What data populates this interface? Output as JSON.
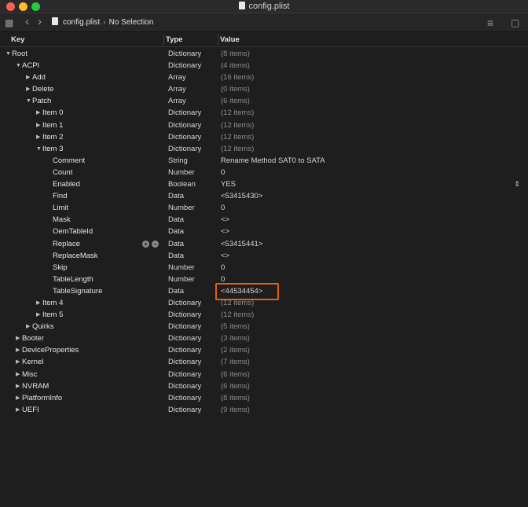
{
  "window": {
    "title": "config.plist"
  },
  "breadcrumb": {
    "file": "config.plist",
    "selection": "No Selection"
  },
  "columns": {
    "key": "Key",
    "type": "Type",
    "value": "Value"
  },
  "rows": [
    {
      "indent": 0,
      "tri": "open",
      "key": "Root",
      "type": "Dictionary",
      "value": "(8 items)",
      "dim": true
    },
    {
      "indent": 1,
      "tri": "open",
      "key": "ACPI",
      "type": "Dictionary",
      "value": "(4 items)",
      "dim": true
    },
    {
      "indent": 2,
      "tri": "closed",
      "key": "Add",
      "type": "Array",
      "value": "(16 items)",
      "dim": true
    },
    {
      "indent": 2,
      "tri": "closed",
      "key": "Delete",
      "type": "Array",
      "value": "(0 items)",
      "dim": true
    },
    {
      "indent": 2,
      "tri": "open",
      "key": "Patch",
      "type": "Array",
      "value": "(6 items)",
      "dim": true
    },
    {
      "indent": 3,
      "tri": "closed",
      "key": "Item 0",
      "type": "Dictionary",
      "value": "(12 items)",
      "dim": true
    },
    {
      "indent": 3,
      "tri": "closed",
      "key": "Item 1",
      "type": "Dictionary",
      "value": "(12 items)",
      "dim": true
    },
    {
      "indent": 3,
      "tri": "closed",
      "key": "Item 2",
      "type": "Dictionary",
      "value": "(12 items)",
      "dim": true
    },
    {
      "indent": 3,
      "tri": "open",
      "key": "Item 3",
      "type": "Dictionary",
      "value": "(12 items)",
      "dim": true
    },
    {
      "indent": 4,
      "tri": "none",
      "key": "Comment",
      "type": "String",
      "value": "Rename Method SAT0 to SATA",
      "dim": false
    },
    {
      "indent": 4,
      "tri": "none",
      "key": "Count",
      "type": "Number",
      "value": "0",
      "dim": false
    },
    {
      "indent": 4,
      "tri": "none",
      "key": "Enabled",
      "type": "Boolean",
      "value": "YES",
      "dim": false,
      "stepper": "⌃⌄"
    },
    {
      "indent": 4,
      "tri": "none",
      "key": "Find",
      "type": "Data",
      "value": "<53415430>",
      "dim": false
    },
    {
      "indent": 4,
      "tri": "none",
      "key": "Limit",
      "type": "Number",
      "value": "0",
      "dim": false
    },
    {
      "indent": 4,
      "tri": "none",
      "key": "Mask",
      "type": "Data",
      "value": "<>",
      "dim": false
    },
    {
      "indent": 4,
      "tri": "none",
      "key": "OemTableId",
      "type": "Data",
      "value": "<>",
      "dim": false
    },
    {
      "indent": 4,
      "tri": "none",
      "key": "Replace",
      "type": "Data",
      "value": "<53415441>",
      "dim": false,
      "addremove": true
    },
    {
      "indent": 4,
      "tri": "none",
      "key": "ReplaceMask",
      "type": "Data",
      "value": "<>",
      "dim": false
    },
    {
      "indent": 4,
      "tri": "none",
      "key": "Skip",
      "type": "Number",
      "value": "0",
      "dim": false
    },
    {
      "indent": 4,
      "tri": "none",
      "key": "TableLength",
      "type": "Number",
      "value": "0",
      "dim": false
    },
    {
      "indent": 4,
      "tri": "none",
      "key": "TableSignature",
      "type": "Data",
      "value": "<44534454>",
      "dim": false
    },
    {
      "indent": 3,
      "tri": "closed",
      "key": "Item 4",
      "type": "Dictionary",
      "value": "(12 items)",
      "dim": true
    },
    {
      "indent": 3,
      "tri": "closed",
      "key": "Item 5",
      "type": "Dictionary",
      "value": "(12 items)",
      "dim": true
    },
    {
      "indent": 2,
      "tri": "closed",
      "key": "Quirks",
      "type": "Dictionary",
      "value": "(5 items)",
      "dim": true
    },
    {
      "indent": 1,
      "tri": "closed",
      "key": "Booter",
      "type": "Dictionary",
      "value": "(3 items)",
      "dim": true
    },
    {
      "indent": 1,
      "tri": "closed",
      "key": "DeviceProperties",
      "type": "Dictionary",
      "value": "(2 items)",
      "dim": true
    },
    {
      "indent": 1,
      "tri": "closed",
      "key": "Kernel",
      "type": "Dictionary",
      "value": "(7 items)",
      "dim": true
    },
    {
      "indent": 1,
      "tri": "closed",
      "key": "Misc",
      "type": "Dictionary",
      "value": "(6 items)",
      "dim": true
    },
    {
      "indent": 1,
      "tri": "closed",
      "key": "NVRAM",
      "type": "Dictionary",
      "value": "(6 items)",
      "dim": true
    },
    {
      "indent": 1,
      "tri": "closed",
      "key": "PlatformInfo",
      "type": "Dictionary",
      "value": "(8 items)",
      "dim": true
    },
    {
      "indent": 1,
      "tri": "closed",
      "key": "UEFI",
      "type": "Dictionary",
      "value": "(9 items)",
      "dim": true
    }
  ],
  "icons": {
    "grid": "▦",
    "back": "‹",
    "forward": "›",
    "align": "≡",
    "inspector": "▢",
    "tri_open": "▼",
    "tri_closed": "▶",
    "add": "+",
    "remove": "−"
  },
  "colors": {
    "highlight": "#e0601a",
    "close": "#fe5f57",
    "minimize": "#febc2e",
    "maximize": "#28c840"
  }
}
